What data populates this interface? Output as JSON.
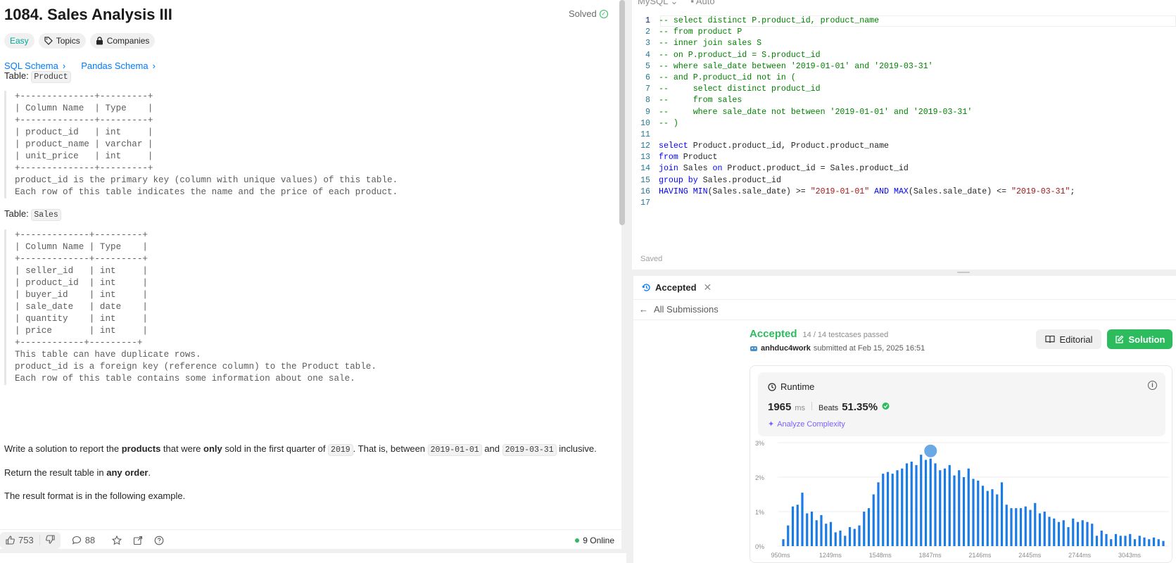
{
  "problem": {
    "title": "1084. Sales Analysis III",
    "solved_label": "Solved",
    "tags": {
      "easy": "Easy",
      "topics": "Topics",
      "companies": "Companies"
    },
    "schema_links": {
      "sql": "SQL Schema",
      "pandas": "Pandas Schema"
    },
    "table_prefix": "Table:",
    "product_table_name": "Product",
    "product_schema": "+--------------+---------+\n| Column Name  | Type    |\n+--------------+---------+\n| product_id   | int     |\n| product_name | varchar |\n| unit_price   | int     |\n+--------------+---------+\nproduct_id is the primary key (column with unique values) of this table.\nEach row of this table indicates the name and the price of each product.",
    "sales_table_name": "Sales",
    "sales_schema": "+-------------+---------+\n| Column Name | Type    |\n+-------------+---------+\n| seller_id   | int     |\n| product_id  | int     |\n| buyer_id    | int     |\n| sale_date   | date    |\n| quantity    | int     |\n| price       | int     |\n+------------+---------+\nThis table can have duplicate rows.\nproduct_id is a foreign key (reference column) to the Product table.\nEach row of this table contains some information about one sale.",
    "desc": {
      "p1_a": "Write a solution to report the ",
      "p1_b": "products",
      "p1_c": " that were ",
      "p1_d": "only",
      "p1_e": " sold in the first quarter of ",
      "p1_f": "2019",
      "p1_g": ". That is, between ",
      "p1_h": "2019-01-01",
      "p1_i": " and ",
      "p1_j": "2019-03-31",
      "p1_k": " inclusive.",
      "p2_a": "Return the result table in ",
      "p2_b": "any order",
      "p2_c": ".",
      "p3": "The result format is in the following example."
    }
  },
  "bottom_bar": {
    "likes": "753",
    "comments": "88",
    "online": "9 Online"
  },
  "editor": {
    "language": "MySQL",
    "mode": "Auto",
    "saved": "Saved",
    "lines": [
      "1",
      "2",
      "3",
      "4",
      "5",
      "6",
      "7",
      "8",
      "9",
      "10",
      "11",
      "12",
      "13",
      "14",
      "15",
      "16",
      "17"
    ]
  },
  "result": {
    "tab_label": "Accepted",
    "all_submissions": "All Submissions",
    "status": "Accepted",
    "testcases": "14 / 14 testcases passed",
    "username": "anhduc4work",
    "submitted_at": " submitted at Feb 15, 2025 16:51",
    "editorial": "Editorial",
    "solution": "Solution",
    "runtime_label": "Runtime",
    "runtime_value": "1965",
    "runtime_unit": "ms",
    "beats_label": "Beats",
    "beats_value": "51.35%",
    "analyze": "Analyze Complexity"
  },
  "chart_data": {
    "type": "bar",
    "y_ticks": [
      "3%",
      "2%",
      "1%",
      "0%"
    ],
    "x_ticks": [
      "950ms",
      "1249ms",
      "1548ms",
      "1847ms",
      "2146ms",
      "2445ms",
      "2744ms",
      "3043ms"
    ],
    "ylim": [
      0,
      3
    ],
    "values": [
      0.2,
      0.6,
      1.15,
      1.2,
      1.55,
      0.95,
      1.0,
      0.75,
      0.9,
      0.65,
      0.7,
      0.4,
      0.45,
      0.3,
      0.55,
      0.5,
      0.6,
      1.0,
      1.1,
      1.5,
      1.85,
      2.1,
      2.15,
      2.1,
      2.2,
      2.25,
      2.4,
      2.45,
      2.35,
      2.65,
      2.5,
      2.7,
      2.4,
      2.2,
      2.25,
      2.35,
      2.05,
      2.2,
      2.0,
      2.25,
      1.95,
      1.9,
      1.75,
      1.6,
      1.65,
      1.5,
      1.85,
      1.2,
      1.1,
      1.1,
      1.1,
      1.15,
      1.05,
      1.25,
      0.95,
      1.0,
      0.85,
      0.8,
      0.7,
      0.75,
      0.55,
      0.8,
      0.7,
      0.75,
      0.7,
      0.65,
      0.3,
      0.45,
      0.35,
      0.2,
      0.35,
      0.3,
      0.3,
      0.35,
      0.2,
      0.3,
      0.25,
      0.2,
      0.25,
      0.2,
      0.15
    ],
    "highlight_index": 31
  }
}
